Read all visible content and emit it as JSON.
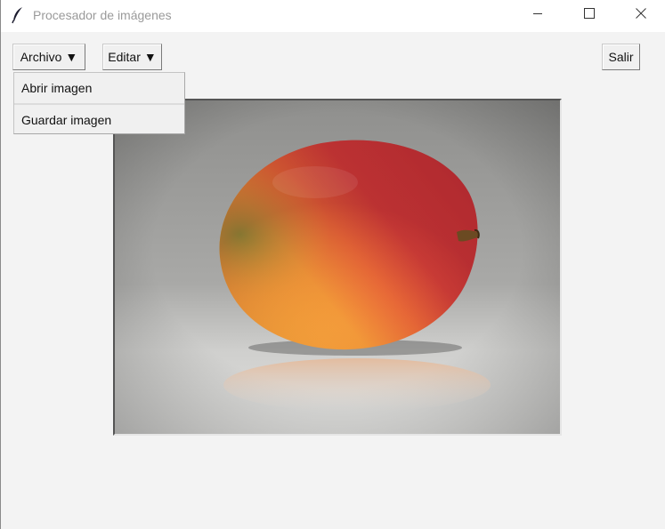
{
  "window": {
    "title": "Procesador de imágenes",
    "icon": "feather-icon",
    "controls": [
      "minimize-icon",
      "maximize-icon",
      "close-icon"
    ]
  },
  "toolbar": {
    "archivo_label": "Archivo",
    "editar_label": "Editar",
    "salir_label": "Salir",
    "arrow_glyph": "▼"
  },
  "menu_archivo": {
    "items": [
      {
        "label": "Abrir imagen"
      },
      {
        "label": "Guardar imagen"
      }
    ]
  },
  "canvas": {
    "content": "mango-photo"
  },
  "colors": {
    "window_bg": "#f3f3f3",
    "titlebar_bg": "#ffffff",
    "button_bg": "#f0f0f0",
    "mango_red": "#d9393a",
    "mango_orange": "#f3a23a",
    "mango_green": "#6f9a3a"
  }
}
